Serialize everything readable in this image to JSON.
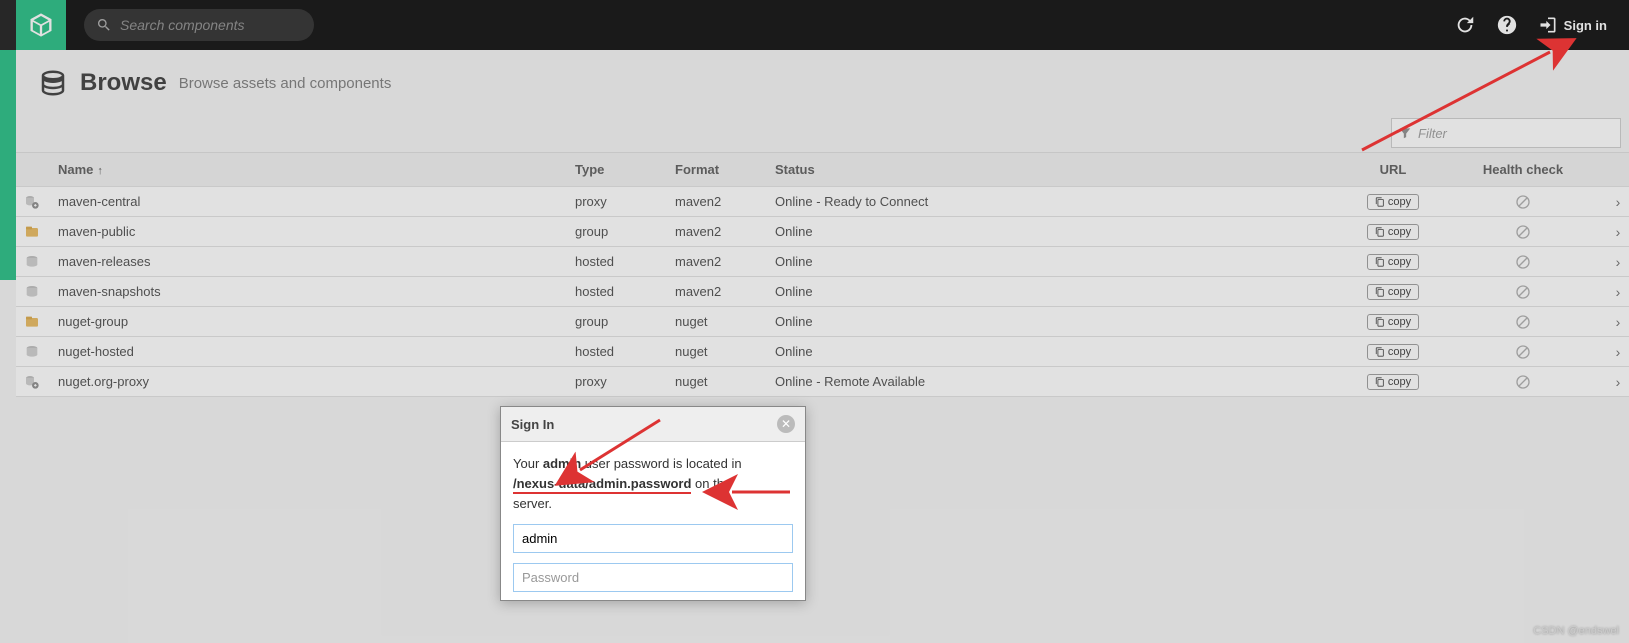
{
  "header": {
    "search_placeholder": "Search components",
    "signin_label": "Sign in"
  },
  "page": {
    "title": "Browse",
    "subtitle": "Browse assets and components"
  },
  "filter": {
    "placeholder": "Filter"
  },
  "columns": {
    "name": "Name",
    "type": "Type",
    "format": "Format",
    "status": "Status",
    "url": "URL",
    "health": "Health check"
  },
  "copy_label": "copy",
  "rows": [
    {
      "icon": "proxy",
      "name": "maven-central",
      "type": "proxy",
      "format": "maven2",
      "status": "Online - Ready to Connect"
    },
    {
      "icon": "group",
      "name": "maven-public",
      "type": "group",
      "format": "maven2",
      "status": "Online"
    },
    {
      "icon": "hosted",
      "name": "maven-releases",
      "type": "hosted",
      "format": "maven2",
      "status": "Online"
    },
    {
      "icon": "hosted",
      "name": "maven-snapshots",
      "type": "hosted",
      "format": "maven2",
      "status": "Online"
    },
    {
      "icon": "group",
      "name": "nuget-group",
      "type": "group",
      "format": "nuget",
      "status": "Online"
    },
    {
      "icon": "hosted",
      "name": "nuget-hosted",
      "type": "hosted",
      "format": "nuget",
      "status": "Online"
    },
    {
      "icon": "proxy",
      "name": "nuget.org-proxy",
      "type": "proxy",
      "format": "nuget",
      "status": "Online - Remote Available"
    }
  ],
  "dialog": {
    "title": "Sign In",
    "msg_prefix": "Your ",
    "msg_admin": "admin",
    "msg_mid": " user password is located in ",
    "msg_path": "/nexus-data/admin.password",
    "msg_suffix1": " on the",
    "msg_suffix2": "server.",
    "username_value": "admin",
    "password_placeholder": "Password"
  },
  "watermark": "CSDN @endswel"
}
